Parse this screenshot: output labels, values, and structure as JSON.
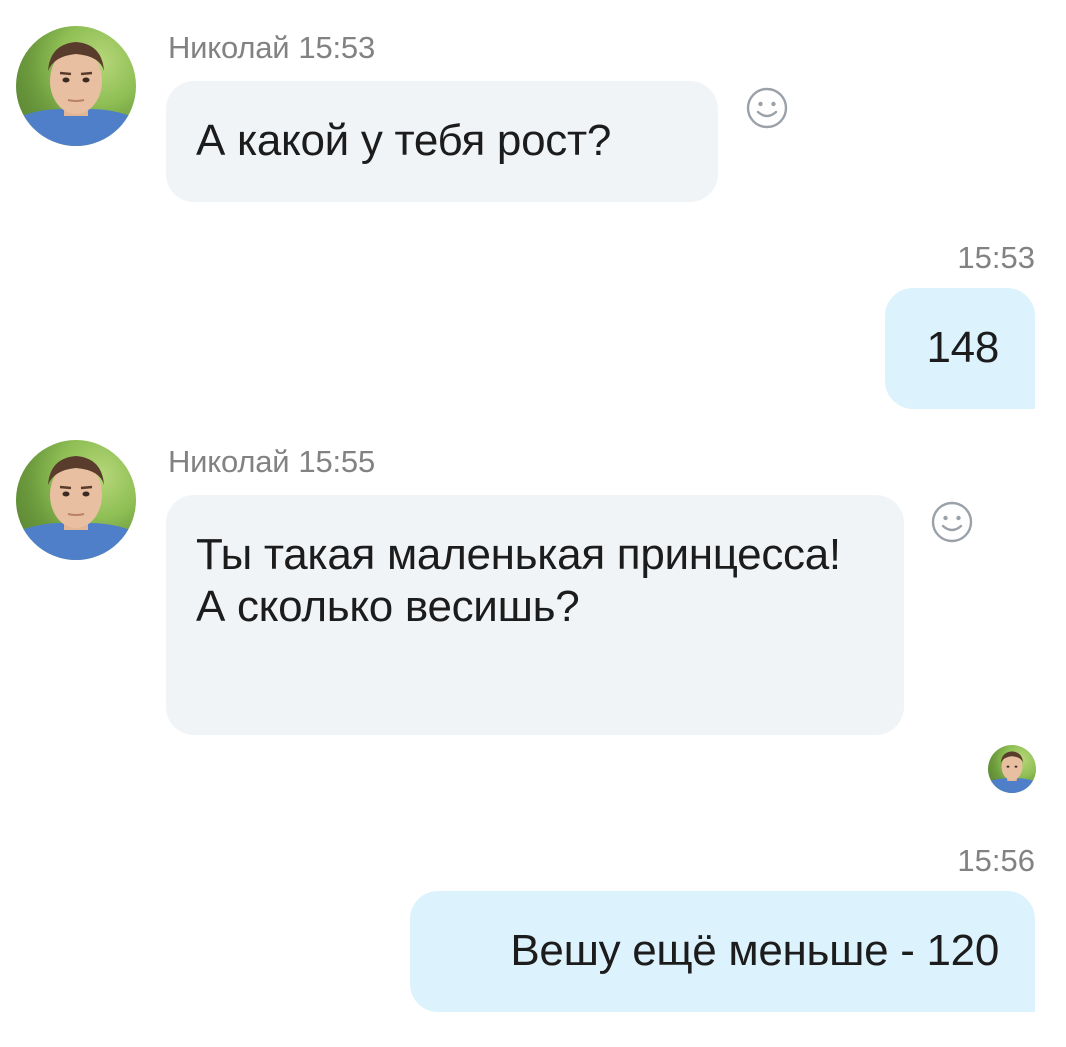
{
  "messages": [
    {
      "direction": "in",
      "sender": "Николай",
      "time": "15:53",
      "text": "А какой у тебя рост?"
    },
    {
      "direction": "out",
      "time": "15:53",
      "text": "148"
    },
    {
      "direction": "in",
      "sender": "Николай",
      "time": "15:55",
      "text": "Ты такая маленькая принцесса! А сколько весишь?"
    },
    {
      "direction": "out",
      "time": "15:56",
      "text": "Вешу ещё меньше - 120"
    }
  ],
  "icons": {
    "avatar": "user-avatar-photo",
    "reaction": "smiley-face-icon",
    "read_receipt": "read-receipt-avatar"
  },
  "colors": {
    "incoming_bubble": "#f1f4f7",
    "outgoing_bubble": "#dcf2fc",
    "meta_text": "#828282",
    "message_text": "#1c1c1c"
  }
}
